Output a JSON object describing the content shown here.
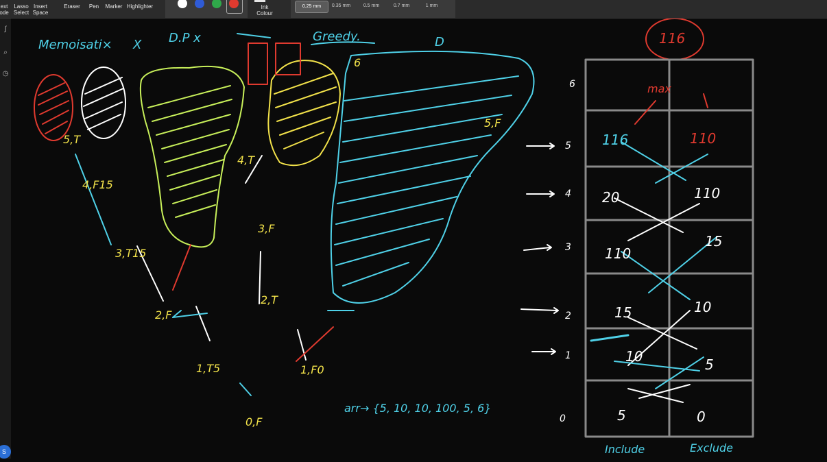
{
  "toolbar": {
    "text_mode": "ext\node",
    "lasso_select": "Lasso\nSelect",
    "insert_space": "Insert\nSpace",
    "eraser": "Eraser",
    "pen": "Pen",
    "marker": "Marker",
    "highlighter": "Highlighter",
    "ink_colour": "Ink\nColour",
    "colors": [
      "#ffffff",
      "#2f5bd6",
      "#2fa84a",
      "#e03a2f"
    ],
    "thickness": [
      "0.25 mm",
      "0.35 mm",
      "0.5 mm",
      "0.7 mm",
      "1 mm"
    ],
    "selected_thickness": "0.25 mm"
  },
  "notes": {
    "title_left": "Memoisati×",
    "title_x": "X",
    "dp": "D.P x",
    "arrow": "→",
    "greedy": "Greedy.",
    "d": "D",
    "arr": "arr→ {5, 10, 10, 100, 5, 6}",
    "max_label": "max",
    "top_value": "116",
    "include": "Include",
    "exclude": "Exclude"
  },
  "tree": {
    "nodes": [
      "0,F",
      "1,T5",
      "1,F0",
      "2,F",
      "2,T",
      "3,T15",
      "3,F",
      "4,F15",
      "4,T",
      "5,T",
      "5,F",
      "6"
    ]
  },
  "table": {
    "rows": [
      {
        "index": "6",
        "include": "",
        "exclude": ""
      },
      {
        "index": "5",
        "include": "116",
        "exclude": "110"
      },
      {
        "index": "4",
        "include": "20",
        "exclude": "110"
      },
      {
        "index": "3",
        "include": "110",
        "exclude": "15"
      },
      {
        "index": "2",
        "include": "15",
        "exclude": "10"
      },
      {
        "index": "1",
        "include": "10",
        "exclude": "5"
      },
      {
        "index": "0",
        "include": "5",
        "exclude": "0"
      }
    ]
  },
  "sidebar": {
    "avatar": "S"
  }
}
